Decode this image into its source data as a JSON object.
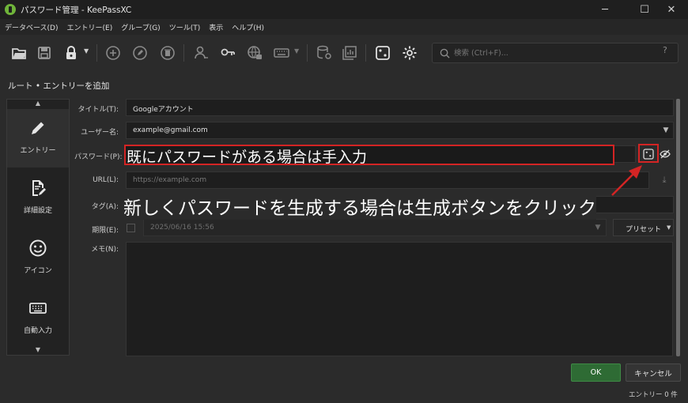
{
  "window": {
    "title": "パスワード管理 - KeePassXC",
    "minimize": "─",
    "maximize": "☐",
    "close": "✕"
  },
  "menu": [
    "データベース(D)",
    "エントリー(E)",
    "グループ(G)",
    "ツール(T)",
    "表示",
    "ヘルプ(H)"
  ],
  "toolbar": {
    "icons": [
      "open-database-icon",
      "save-database-icon",
      "lock-database-icon",
      "lock-dropdown-icon",
      "add-entry-icon",
      "edit-entry-icon",
      "delete-entry-icon",
      "copy-username-icon",
      "copy-password-icon",
      "copy-url-icon",
      "autotype-icon",
      "autotype-dropdown-icon",
      "database-reports-icon",
      "database-settings-icon",
      "password-generator-icon",
      "settings-icon"
    ],
    "search_placeholder": "検索 (Ctrl+F)...",
    "search_help": "?"
  },
  "breadcrumb": "ルート • エントリーを追加",
  "sidebar": {
    "up_arrow": "▲",
    "down_arrow": "▼",
    "items": [
      {
        "label": "エントリー",
        "icon": "pencil-icon",
        "active": true
      },
      {
        "label": "詳細設定",
        "icon": "document-edit-icon",
        "active": false
      },
      {
        "label": "アイコン",
        "icon": "smiley-icon",
        "active": false
      },
      {
        "label": "自動入力",
        "icon": "keyboard-icon",
        "active": false
      }
    ]
  },
  "form": {
    "title_label": "タイトル(T):",
    "title_value": "Googleアカウント",
    "username_label": "ユーザー名:",
    "username_value": "example@gmail.com",
    "password_label": "パスワード(P):",
    "url_label": "URL(L):",
    "url_placeholder": "https://example.com",
    "tags_label": "タグ(A):",
    "expires_label": "期限(E):",
    "expires_value": "2025/06/16 15:56",
    "presets_label": "プリセット",
    "notes_label": "メモ(N):",
    "combo_arrow": "▼",
    "download_icon": "⤓"
  },
  "annotations": {
    "manual_entry_text": "既にパスワードがある場合は手入力",
    "generate_text": "新しくパスワードを生成する場合は生成ボタンをクリック",
    "highlight_color": "#d32424"
  },
  "buttons": {
    "ok": "OK",
    "cancel": "キャンセル"
  },
  "status": "エントリー 0 件"
}
